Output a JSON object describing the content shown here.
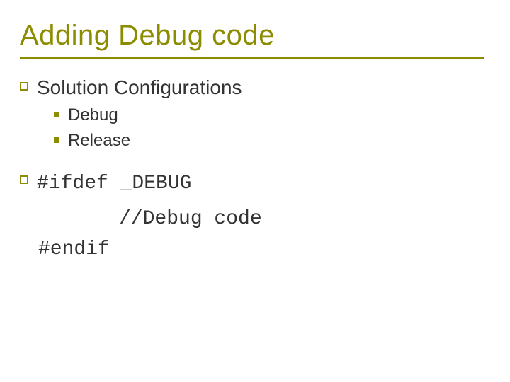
{
  "title": "Adding Debug code",
  "items": [
    {
      "text": "Solution Configurations",
      "sub": [
        {
          "text": "Debug"
        },
        {
          "text": "Release"
        }
      ]
    }
  ],
  "code": {
    "line1": "#ifdef _DEBUG",
    "line2": "//Debug code",
    "line3": "#endif"
  }
}
